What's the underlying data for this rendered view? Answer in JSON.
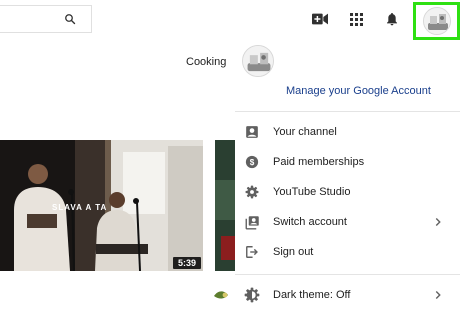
{
  "topbar": {
    "search_icon": "search-icon",
    "icons": [
      "video-camera-plus-icon",
      "apps-grid-icon",
      "bell-icon",
      "avatar"
    ],
    "highlight_color": "#2ee012"
  },
  "account": {
    "name": "Cooking",
    "manage_link": "Manage your Google Account"
  },
  "menu": {
    "items": [
      {
        "label": "Your channel",
        "icon": "person-icon"
      },
      {
        "label": "Paid memberships",
        "icon": "dollar-icon"
      },
      {
        "label": "YouTube Studio",
        "icon": "gear-icon"
      },
      {
        "label": "Switch account",
        "icon": "switch-account-icon",
        "has_submenu": true
      },
      {
        "label": "Sign out",
        "icon": "sign-out-icon"
      },
      {
        "label": "Dark theme: Off",
        "icon": "dark-theme-icon",
        "has_submenu": true
      }
    ]
  },
  "video": {
    "duration": "5:39",
    "overlay_text": "SLAVA  A TA"
  },
  "colors": {
    "link": "#1a3f8c",
    "icon": "#606060"
  }
}
